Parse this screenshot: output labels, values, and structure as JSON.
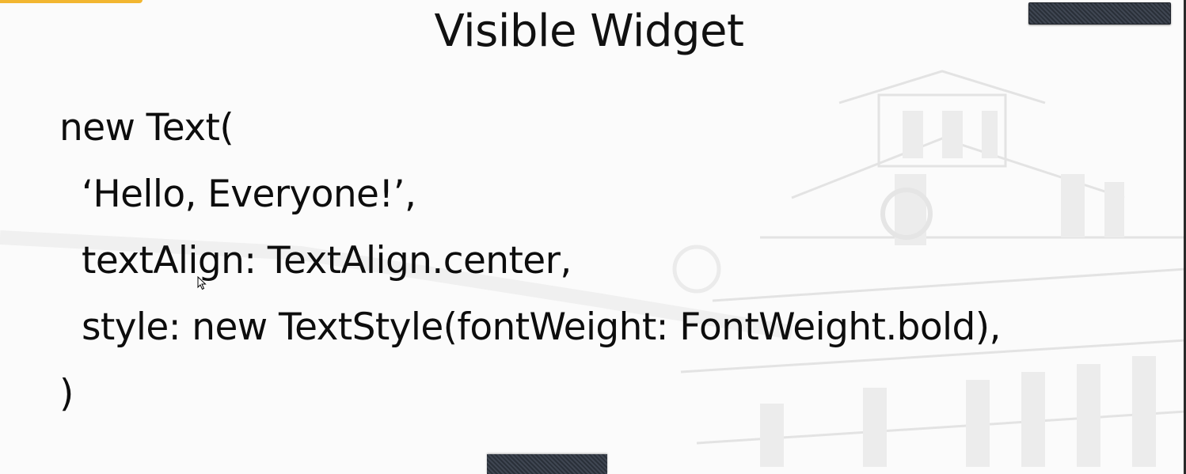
{
  "slide": {
    "title": "Visible Widget",
    "code_lines": [
      "new Text(",
      "‘Hello, Everyone!’,",
      "textAlign: TextAlign.center,",
      "style: new TextStyle(fontWeight: FontWeight.bold),",
      ")"
    ]
  },
  "colors": {
    "accent": "#f2b630",
    "text": "#111111",
    "overlay": "#2f3540"
  },
  "icons": {
    "cursor": "mouse-pointer-icon"
  }
}
